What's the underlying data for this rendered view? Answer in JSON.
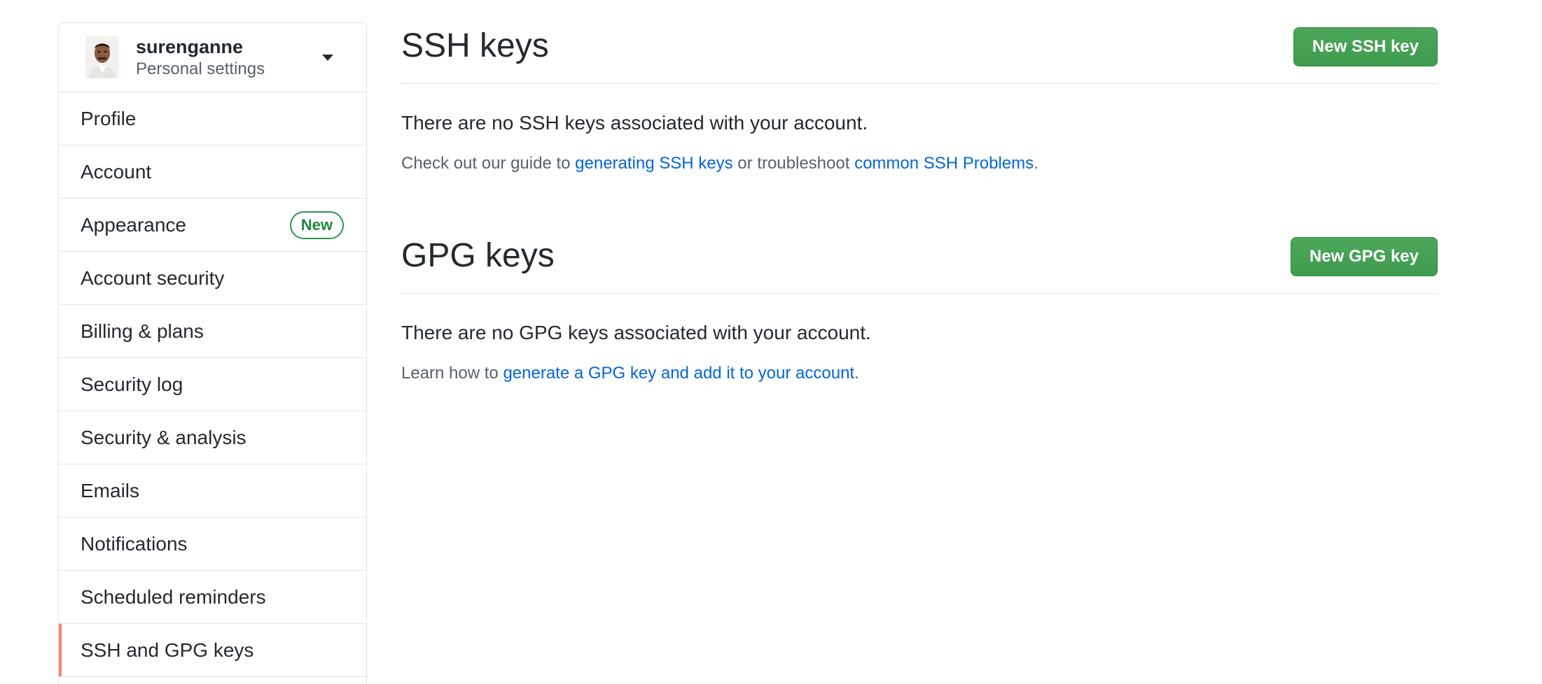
{
  "sidebar": {
    "user": {
      "username": "surenganne",
      "subtitle": "Personal settings"
    },
    "items": [
      {
        "label": "Profile"
      },
      {
        "label": "Account"
      },
      {
        "label": "Appearance",
        "badge": "New"
      },
      {
        "label": "Account security"
      },
      {
        "label": "Billing & plans"
      },
      {
        "label": "Security log"
      },
      {
        "label": "Security & analysis"
      },
      {
        "label": "Emails"
      },
      {
        "label": "Notifications"
      },
      {
        "label": "Scheduled reminders"
      },
      {
        "label": "SSH and GPG keys",
        "selected": true
      }
    ]
  },
  "ssh": {
    "title": "SSH keys",
    "button": "New SSH key",
    "empty": "There are no SSH keys associated with your account.",
    "help_prefix": "Check out our guide to ",
    "help_link1": "generating SSH keys",
    "help_middle": " or troubleshoot ",
    "help_link2": "common SSH Problems",
    "help_suffix": "."
  },
  "gpg": {
    "title": "GPG keys",
    "button": "New GPG key",
    "empty": "There are no GPG keys associated with your account.",
    "help_prefix": "Learn how to ",
    "help_link": "generate a GPG key and add it to your account",
    "help_suffix": "."
  },
  "colors": {
    "accent_green": "#2ea44f",
    "link_blue": "#0366d6",
    "selected_marker": "#f9826c"
  }
}
